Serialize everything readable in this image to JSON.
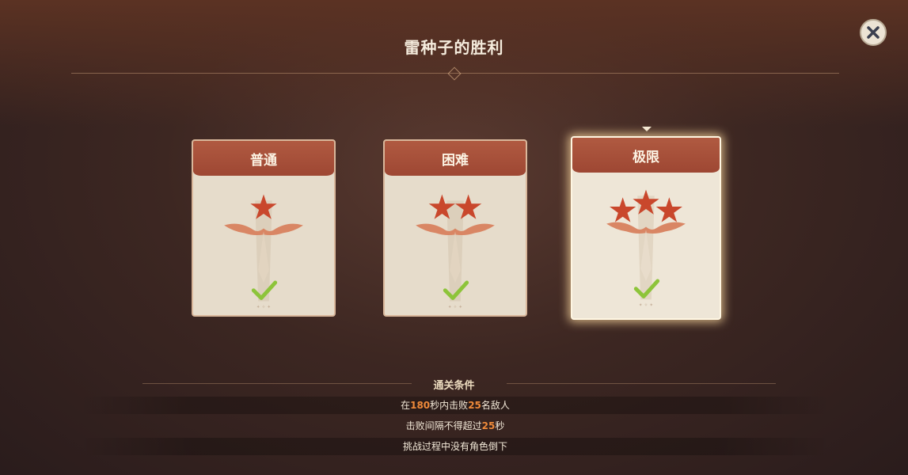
{
  "header": {
    "title": "雷种子的胜利"
  },
  "close_icon": "close-x-icon",
  "difficulties": [
    {
      "label": "普通",
      "stars": 1,
      "completed": true
    },
    {
      "label": "困难",
      "stars": 2,
      "completed": true
    },
    {
      "label": "极限",
      "stars": 3,
      "completed": true,
      "selected": true
    }
  ],
  "conditions": {
    "title": "通关条件",
    "rows": [
      {
        "before": "在",
        "num1": "180",
        "mid": "秒内击败",
        "num2": "25",
        "after": "名敌人"
      },
      {
        "before": "击败间隔不得超过",
        "num1": "25",
        "mid": "秒",
        "num2": "",
        "after": ""
      },
      {
        "before": "挑战过程中没有角色倒下",
        "num1": "",
        "mid": "",
        "num2": "",
        "after": ""
      }
    ]
  },
  "colors": {
    "accent_red": "#a24a36",
    "check_green": "#8dc43a",
    "highlight": "#ef8a3a"
  }
}
